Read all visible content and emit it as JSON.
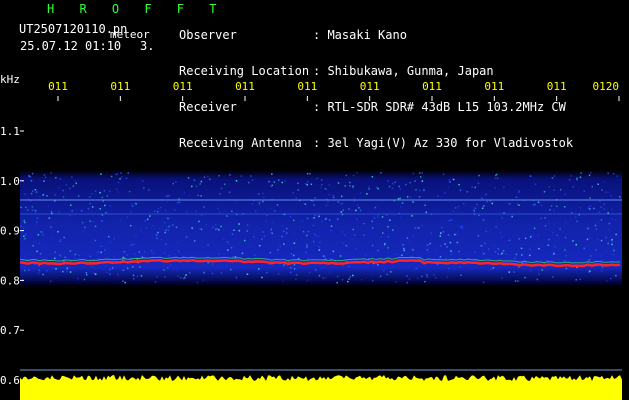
{
  "header": {
    "brand": "H R O F F T",
    "filename": "UT2507120110.pn",
    "file_type": "meteor",
    "datetime": "25.07.12 01:10",
    "count": "3."
  },
  "info": {
    "labels": [
      "Observer",
      "Receiving Location",
      "Receiver",
      "Receiving Antenna"
    ],
    "values": [
      ": Masaki Kano",
      ": Shibukawa, Gunma, Japan",
      ": RTL-SDR SDR# 43dB L15 103.2MHz CW",
      ": 3el Yagi(V) Az 330 for Vladivostok"
    ]
  },
  "chart_data": {
    "type": "heatmap",
    "yunit": "kHz",
    "y_ticks": [
      "1.1",
      "1.0",
      "0.9",
      "0.8",
      "0.7",
      "0.6"
    ],
    "time_ticks": [
      "011",
      "011",
      "011",
      "011",
      "011",
      "011",
      "011",
      "011",
      "011",
      "0120"
    ],
    "signal_band_khz": 0.837,
    "noise_band_khz": [
      0.8,
      1.0
    ],
    "colors": {
      "background": "#000000",
      "noise": "#1a2cff",
      "signal": "#ff2020",
      "power_bar": "#ffff00"
    }
  }
}
